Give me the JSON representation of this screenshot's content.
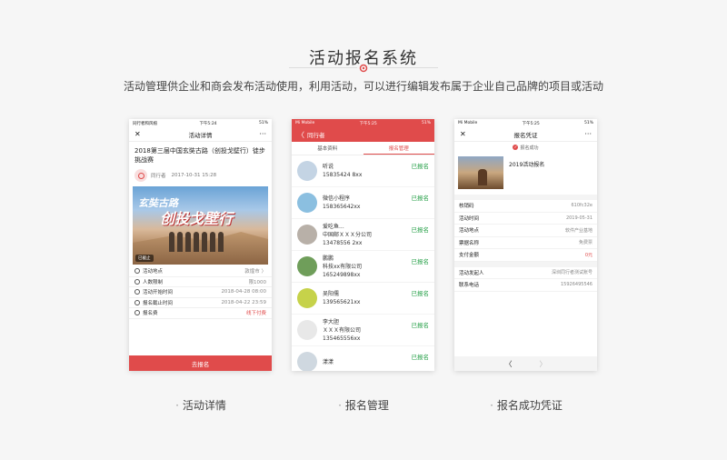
{
  "header": {
    "title": "活动报名系统",
    "subtitle": "活动管理供企业和商会发布活动使用，利用活动，可以进行编辑发布属于企业自己品牌的项目或活动"
  },
  "phone1": {
    "status": {
      "carrier": "同行者和风榕",
      "time": "下午5:24",
      "battery": "51%"
    },
    "nav": {
      "title": "活动详情",
      "left": "✕",
      "right": "···"
    },
    "event_title": "2018第三届中国玄奘古路（创投戈壁行）徒步挑战赛",
    "organizer": "同行者",
    "date": "2017-10-31 15:28",
    "banner": {
      "text1": "玄奘古路",
      "text2": "创投戈壁行",
      "tag": "已截止"
    },
    "rows": [
      {
        "label": "活动地点",
        "value": "敦煌市 〉"
      },
      {
        "label": "人数限制",
        "value": "限1000"
      },
      {
        "label": "活动开始时间",
        "value": "2018-04-28 08:00"
      },
      {
        "label": "报名截止时间",
        "value": "2018-04-22 23:59"
      },
      {
        "label": "报名费",
        "value": "线下付费"
      }
    ],
    "button": "去报名"
  },
  "phone2": {
    "status": {
      "carrier": "Mi Mobile",
      "time": "下午5:25",
      "battery": "51%"
    },
    "nav": {
      "left": "〈",
      "title": "同行者"
    },
    "tabs": [
      "基本资料",
      "报名管理"
    ],
    "members": [
      {
        "name": "听说",
        "company": "",
        "phone": "15835424 8xx",
        "status": "已报名",
        "color": "#c4d4e4"
      },
      {
        "name": "微信小程序",
        "company": "",
        "phone": "158365642xx",
        "status": "已报名",
        "color": "#8bbfe0"
      },
      {
        "name": "爱吃鱼...",
        "company": "中国邮ＸＸＸ分公司",
        "phone": "13478556 2xx",
        "status": "已报名",
        "color": "#b8b0a8"
      },
      {
        "name": "鹏鹏",
        "company": "科技xx有限公司",
        "phone": "165249898xx",
        "status": "已报名",
        "color": "#6f9e5a"
      },
      {
        "name": "吴阳儒",
        "company": "",
        "phone": "139565621xx",
        "status": "已报名",
        "color": "#c6d24a"
      },
      {
        "name": "李大胆",
        "company": "ＸＸＸ有限公司",
        "phone": "135465556xx",
        "status": "已报名",
        "color": "#e8e8e8"
      },
      {
        "name": "漾漾",
        "company": "",
        "phone": "",
        "status": "已报名",
        "color": "#cfd8e0"
      }
    ]
  },
  "phone3": {
    "status": {
      "carrier": "Mi Mobile",
      "time": "下午5:25",
      "battery": "51%"
    },
    "nav": {
      "title": "报名凭证",
      "left": "✕",
      "right": "···"
    },
    "success": "报名成功",
    "ticket_name": "2019活动报名",
    "rows": [
      {
        "key": "核销码",
        "value": "610fc32e"
      },
      {
        "key": "活动时间",
        "value": "2019-05-31"
      },
      {
        "key": "活动地点",
        "value": "软件产业基地"
      },
      {
        "key": "票据名称",
        "value": "免费票"
      },
      {
        "key": "支付金额",
        "value": "0元"
      }
    ],
    "rows2": [
      {
        "key": "活动发起人",
        "value": "深圳同行者测试账号"
      },
      {
        "key": "联系电话",
        "value": "15926495546"
      }
    ],
    "footer": {
      "back": "〈",
      "forward": "〉"
    }
  },
  "captions": [
    "活动详情",
    "报名管理",
    "报名成功凭证"
  ]
}
